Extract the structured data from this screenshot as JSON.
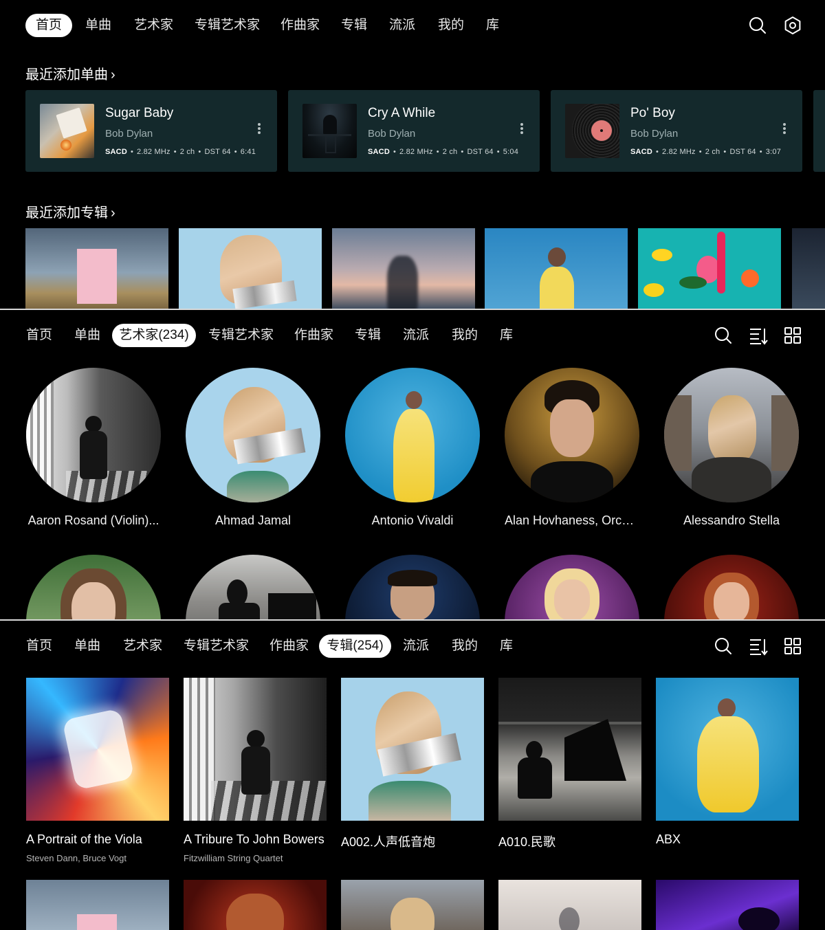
{
  "home_view": {
    "tabs": [
      "首页",
      "单曲",
      "艺术家",
      "专辑艺术家",
      "作曲家",
      "专辑",
      "流派",
      "我的",
      "库"
    ],
    "active_tab": "首页",
    "toolbar_icons": [
      "search-icon",
      "settings-icon"
    ],
    "recent_tracks_title": "最近添加单曲",
    "recent_albums_title": "最近添加专辑",
    "chevron": "›",
    "recent_tracks": [
      {
        "title": "Sugar Baby",
        "artist": "Bob Dylan",
        "format": "SACD",
        "rate": "2.82 MHz",
        "channels": "2 ch",
        "dst": "DST 64",
        "duration": "6:41"
      },
      {
        "title": "Cry A While",
        "artist": "Bob Dylan",
        "format": "SACD",
        "rate": "2.82 MHz",
        "channels": "2 ch",
        "dst": "DST 64",
        "duration": "5:04"
      },
      {
        "title": "Po' Boy",
        "artist": "Bob Dylan",
        "format": "SACD",
        "rate": "2.82 MHz",
        "channels": "2 ch",
        "dst": "DST 64",
        "duration": "3:07"
      }
    ]
  },
  "artists_view": {
    "tabs": [
      "首页",
      "单曲",
      "艺术家(234)",
      "专辑艺术家",
      "作曲家",
      "专辑",
      "流派",
      "我的",
      "库"
    ],
    "active_tab": "艺术家(234)",
    "toolbar_icons": [
      "search-icon",
      "sort-icon",
      "grid-view-icon"
    ],
    "artists": [
      "Aaron Rosand (Violin)...",
      "Ahmad Jamal",
      "Antonio Vivaldi",
      "Alan Hovhaness, Orch....",
      "Alessandro Stella"
    ]
  },
  "albums_view": {
    "tabs": [
      "首页",
      "单曲",
      "艺术家",
      "专辑艺术家",
      "作曲家",
      "专辑(254)",
      "流派",
      "我的",
      "库"
    ],
    "active_tab": "专辑(254)",
    "toolbar_icons": [
      "search-icon",
      "sort-icon",
      "grid-view-icon"
    ],
    "albums": [
      {
        "title": "A Portrait of the Viola",
        "artist": "Steven Dann, Bruce Vogt"
      },
      {
        "title": "A Tribure To John Bowers",
        "artist": "Fitzwilliam String Quartet"
      },
      {
        "title": "A002.人声低音炮",
        "artist": ""
      },
      {
        "title": "A010.民歌",
        "artist": ""
      },
      {
        "title": "ABX",
        "artist": ""
      }
    ]
  }
}
